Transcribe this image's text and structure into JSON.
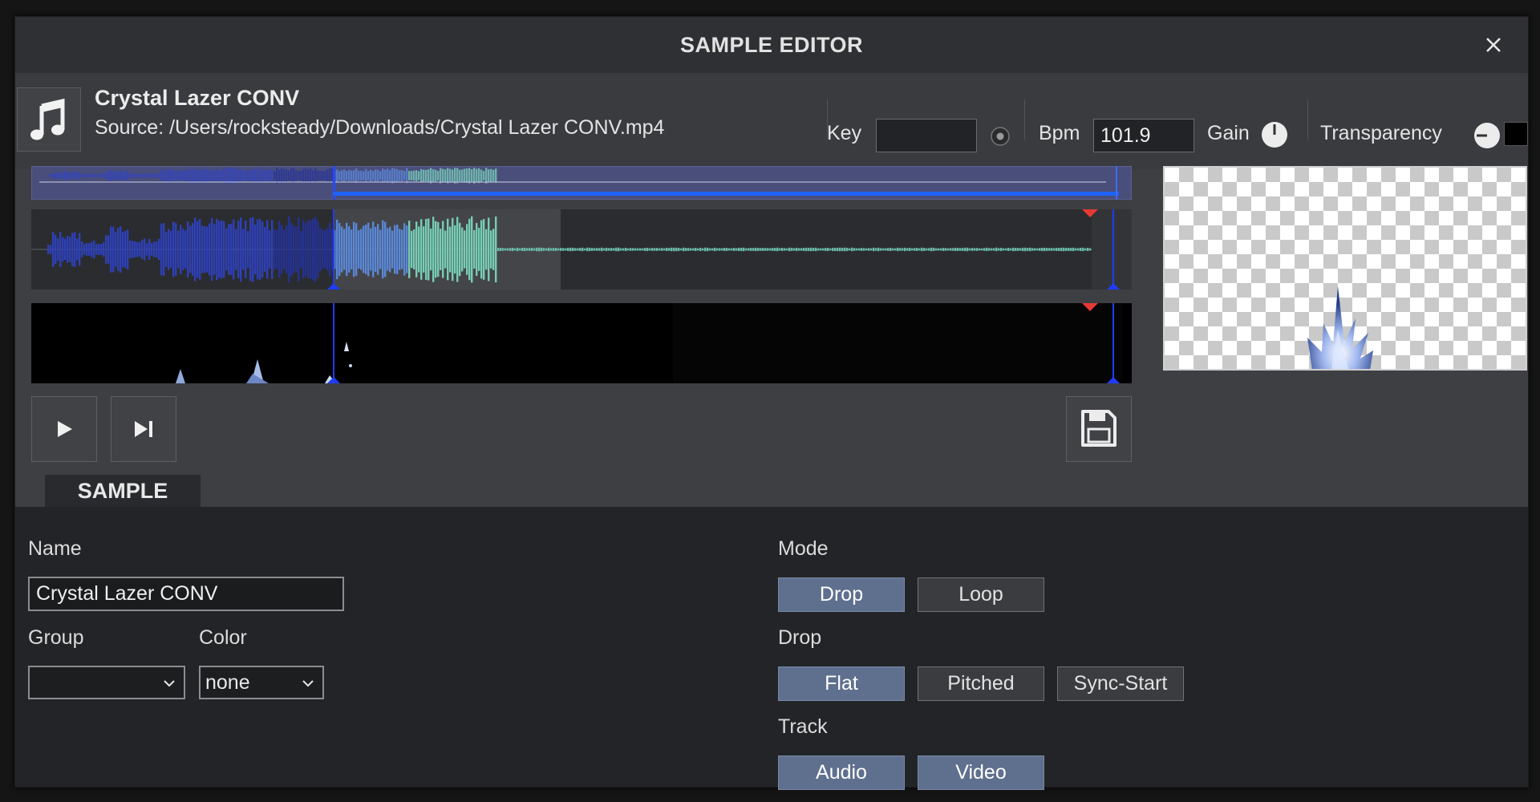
{
  "dialog": {
    "title": "SAMPLE EDITOR"
  },
  "icons": {
    "close": "close-icon",
    "music": "music-note-icon",
    "play": "play-icon",
    "skip": "skip-to-end-icon",
    "save": "save-floppy-icon",
    "chevron": "chevron-down-icon"
  },
  "info": {
    "name": "Crystal Lazer CONV",
    "source": "Source: /Users/rocksteady/Downloads/Crystal Lazer CONV.mp4",
    "key_label": "Key",
    "key_value": "",
    "bpm_label": "Bpm",
    "bpm_value": "101.9",
    "gain_label": "Gain",
    "transparency_label": "Transparency"
  },
  "tab": {
    "label": "SAMPLE"
  },
  "form": {
    "name_label": "Name",
    "name_value": "Crystal Lazer CONV",
    "group_label": "Group",
    "group_value": "",
    "color_label": "Color",
    "color_value": "none"
  },
  "mode": {
    "label": "Mode",
    "options": [
      {
        "label": "Drop",
        "active": true
      },
      {
        "label": "Loop",
        "active": false
      }
    ]
  },
  "drop": {
    "label": "Drop",
    "options": [
      {
        "label": "Flat",
        "active": true
      },
      {
        "label": "Pitched",
        "active": false
      },
      {
        "label": "Sync-Start",
        "active": false
      }
    ]
  },
  "track": {
    "label": "Track",
    "options": [
      {
        "label": "Audio",
        "active": true
      },
      {
        "label": "Video",
        "active": true
      }
    ]
  },
  "colors": {
    "active_button": "#5f6f8e",
    "cue_marker": "#e53935",
    "playhead": "#1f3cff",
    "wave_blue": "#3a4fd6",
    "wave_mint": "#7be0c4"
  }
}
